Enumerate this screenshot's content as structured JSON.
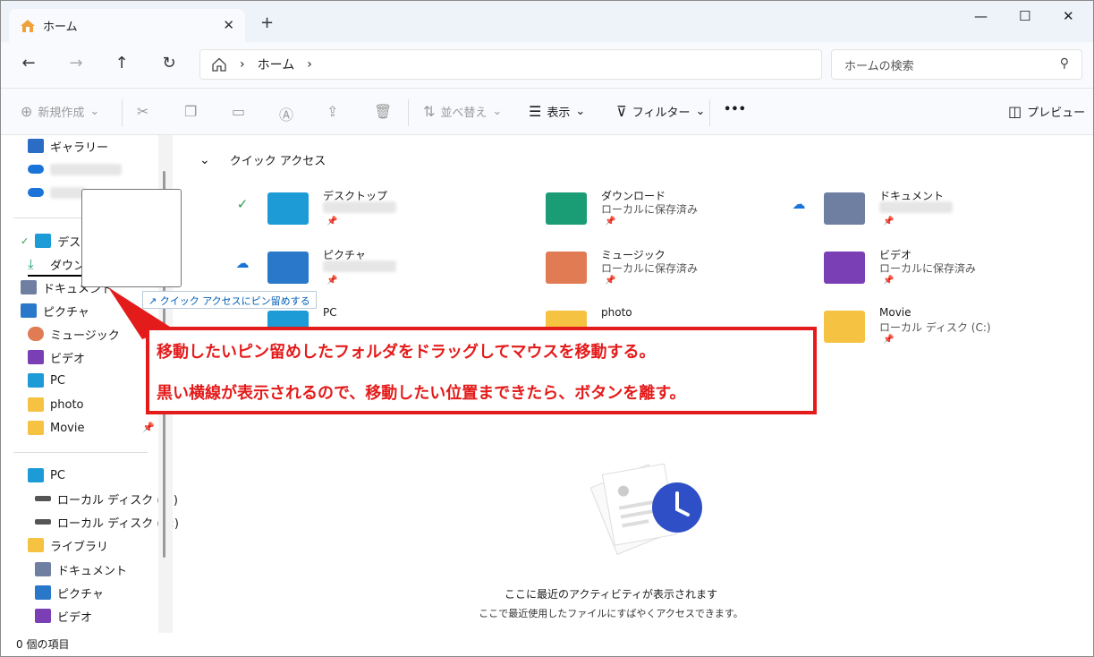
{
  "tab": {
    "title": "ホーム",
    "close": "✕",
    "new": "+"
  },
  "window_controls": {
    "minimize": "—",
    "maximize": "☐",
    "close": "✕"
  },
  "address": {
    "back": "←",
    "forward": "→",
    "up": "↑",
    "refresh": "↻",
    "home": "ホーム",
    "sep": "›",
    "sep2": "›",
    "search_placeholder": "ホームの検索"
  },
  "toolbar": {
    "new": "新規作成",
    "sort": "並べ替え",
    "view": "表示",
    "filter": "フィルター",
    "more": "•••",
    "preview": "プレビュー"
  },
  "sidebar": {
    "top": [
      {
        "label": "ギャラリー",
        "color": "#2b6cc4"
      },
      {
        "label": "",
        "color": "#1a73d9"
      },
      {
        "label": "",
        "color": "#1a73d9"
      }
    ],
    "quick": [
      {
        "label": "デスクト",
        "color": "#1d9bd6"
      },
      {
        "label": "ダウンロ",
        "color": "#1a9c74"
      },
      {
        "label": "ドキュメント",
        "color": "#6e7fa2"
      },
      {
        "label": "ピクチャ",
        "color": "#2a78c9"
      },
      {
        "label": "ミュージック",
        "color": "#e07b53"
      },
      {
        "label": "ビデオ",
        "color": "#7b3fb5"
      },
      {
        "label": "PC",
        "color": "#1d9bd6"
      },
      {
        "label": "photo",
        "color": "#f5c242"
      },
      {
        "label": "Movie",
        "color": "#f5c242"
      }
    ],
    "bottom": [
      {
        "label": "PC",
        "color": "#1d9bd6"
      },
      {
        "label": "ローカル ディスク (C:)",
        "color": "#555"
      },
      {
        "label": "ローカル ディスク (D:)",
        "color": "#555"
      },
      {
        "label": "ライブラリ",
        "color": "#f5c242"
      },
      {
        "label": "ドキュメント",
        "color": "#6e7fa2"
      },
      {
        "label": "ピクチャ",
        "color": "#2a78c9"
      },
      {
        "label": "ビデオ",
        "color": "#7b3fb5"
      }
    ]
  },
  "status": "0 個の項目",
  "quick_access": {
    "heading": "クイック アクセス",
    "items": [
      {
        "name": "デスクトップ",
        "sub": "",
        "color": "#1d9bd6",
        "status": "✓"
      },
      {
        "name": "ダウンロード",
        "sub": "ローカルに保存済み",
        "color": "#1a9c74",
        "status": ""
      },
      {
        "name": "ドキュメント",
        "sub": "",
        "color": "#6e7fa2",
        "status": "☁"
      },
      {
        "name": "ピクチャ",
        "sub": "",
        "color": "#2a78c9",
        "status": "☁"
      },
      {
        "name": "ミュージック",
        "sub": "ローカルに保存済み",
        "color": "#e07b53",
        "status": ""
      },
      {
        "name": "ビデオ",
        "sub": "ローカルに保存済み",
        "color": "#7b3fb5",
        "status": ""
      },
      {
        "name": "PC",
        "sub": "",
        "color": "#1d9bd6",
        "status": ""
      },
      {
        "name": "photo",
        "sub": "",
        "color": "#f5c242",
        "status": ""
      },
      {
        "name": "Movie",
        "sub": "ローカル ディスク (C:)",
        "color": "#f5c242",
        "status": ""
      }
    ]
  },
  "empty": {
    "title": "ここに最近のアクティビティが表示されます",
    "subtitle": "ここで最近使用したファイルにすばやくアクセスできます。"
  },
  "drag_tooltip": "↗ クイック アクセスにピン留めする",
  "callout": {
    "line1": "移動したいピン留めしたフォルダをドラッグしてマウスを移動する。",
    "line2": "黒い横線が表示されるので、移動したい位置まできたら、ボタンを離す。"
  }
}
